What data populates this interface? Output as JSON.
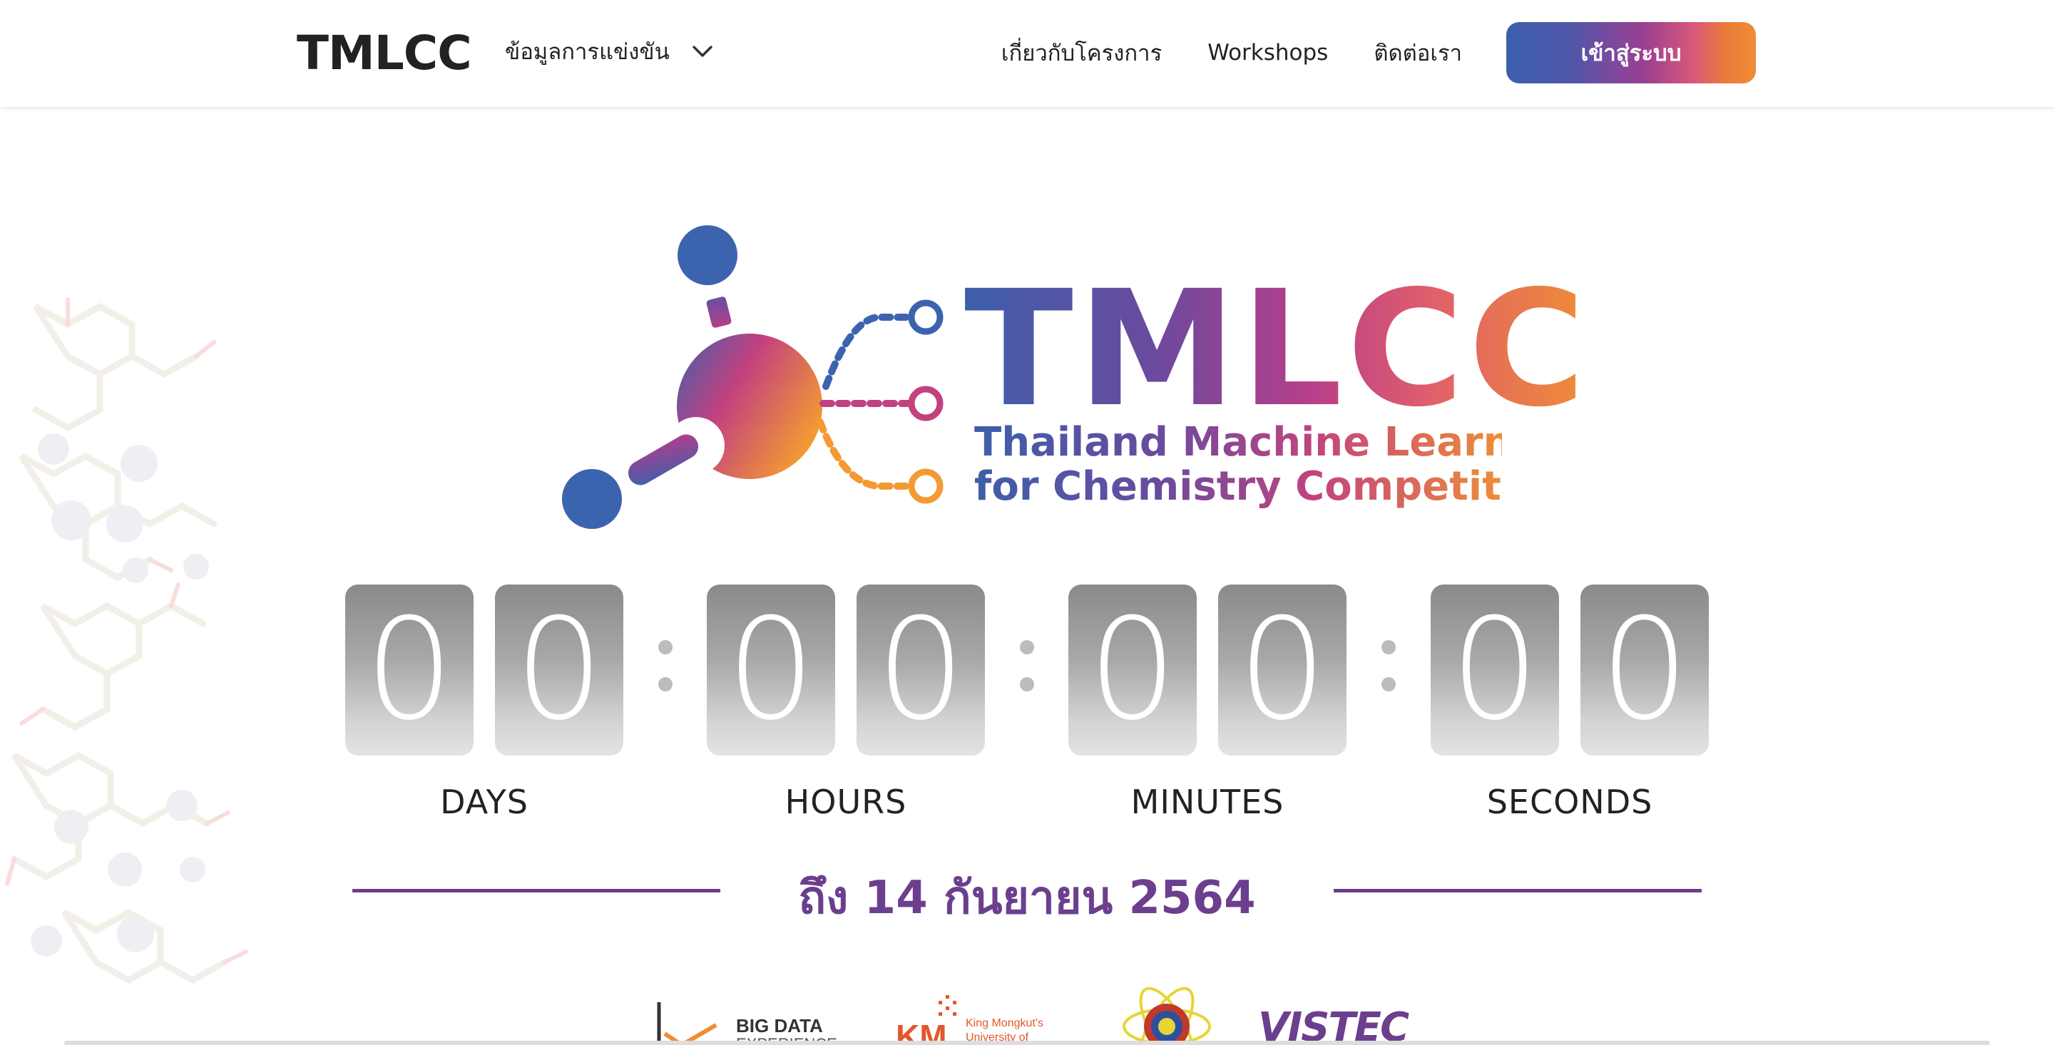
{
  "header": {
    "brand": "TMLCC",
    "dropdown_label": "ข้อมูลการแข่งขัน",
    "nav": [
      "เกี่ยวกับโครงการ",
      "Workshops",
      "ติดต่อเรา"
    ],
    "login_label": "เข้าสู่ระบบ"
  },
  "hero": {
    "logo_word": "TMLCC",
    "subtitle_line1": "Thailand Machine Learning",
    "subtitle_line2": "for Chemistry Competition"
  },
  "countdown": {
    "days": [
      "0",
      "0"
    ],
    "hours": [
      "0",
      "0"
    ],
    "minutes": [
      "0",
      "0"
    ],
    "seconds": [
      "0",
      "0"
    ],
    "labels": {
      "days": "DAYS",
      "hours": "HOURS",
      "minutes": "MINUTES",
      "seconds": "SECONDS"
    }
  },
  "deadline": "ถึง 14 กันยายน 2564",
  "sponsors": {
    "big_data_line1": "BIG DATA",
    "big_data_line2": "EXPERIENCE",
    "km_abbr": "KM",
    "km_line1": "King Mongkut's",
    "km_line2": "University of",
    "vistec": "VISTEC"
  },
  "colors": {
    "brand_blue": "#3c5fae",
    "brand_purple": "#6b3f8e",
    "brand_magenta": "#c2447e",
    "brand_orange": "#ef8d36"
  }
}
